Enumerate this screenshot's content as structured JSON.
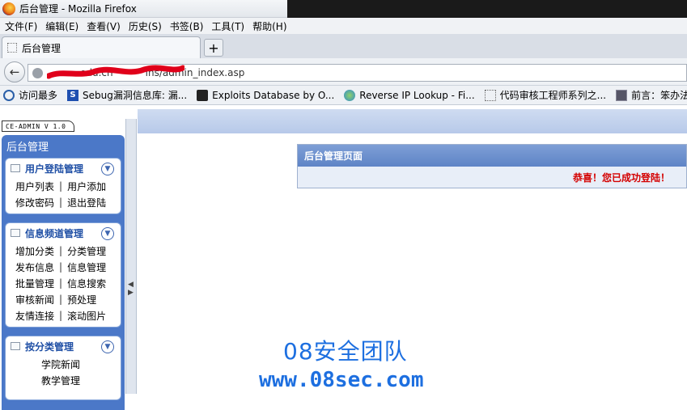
{
  "window": {
    "title": "后台管理 - Mozilla Firefox"
  },
  "menu": [
    "文件(F)",
    "编辑(E)",
    "查看(V)",
    "历史(S)",
    "书签(B)",
    "工具(T)",
    "帮助(H)"
  ],
  "tab": {
    "title": "后台管理",
    "new_tab": "+"
  },
  "address": {
    "host": "edu.cn",
    "path": "ins/admin_index.asp"
  },
  "bookmarks": [
    {
      "label": "访问最多",
      "icon": "search-icon"
    },
    {
      "label": "Sebug漏洞信息库: 漏...",
      "icon": "s-logo-icon"
    },
    {
      "label": "Exploits Database by O...",
      "icon": "exploit-icon"
    },
    {
      "label": "Reverse IP Lookup - Fi...",
      "icon": "globe-icon"
    },
    {
      "label": "代码审核工程师系列之...",
      "icon": "page-icon"
    },
    {
      "label": "前言：笨办法更简单 ...",
      "icon": "book-icon"
    }
  ],
  "sidebar": {
    "logo": "CE-ADMIN V 1.0",
    "title": "后台管理",
    "sections": [
      {
        "title": "用户登陆管理",
        "rows": [
          [
            "用户列表",
            "用户添加"
          ],
          [
            "修改密码",
            "退出登陆"
          ]
        ]
      },
      {
        "title": "信息频道管理",
        "rows": [
          [
            "增加分类",
            "分类管理"
          ],
          [
            "发布信息",
            "信息管理"
          ],
          [
            "批量管理",
            "信息搜索"
          ],
          [
            "审核新闻",
            "预处理"
          ],
          [
            "友情连接",
            "滚动图片"
          ]
        ]
      },
      {
        "title": "按分类管理",
        "items": [
          "学院新闻",
          "教学管理"
        ]
      }
    ]
  },
  "main": {
    "header": "后台管理页面",
    "message": "恭喜！您已成功登陆！"
  },
  "watermark": {
    "line1": "08安全团队",
    "line2": "www.08sec.com"
  },
  "colors": {
    "sidebar": "#4b78c8",
    "accent": "#1f4fa5",
    "success": "#d40000",
    "watermark": "#1d6fe0"
  }
}
